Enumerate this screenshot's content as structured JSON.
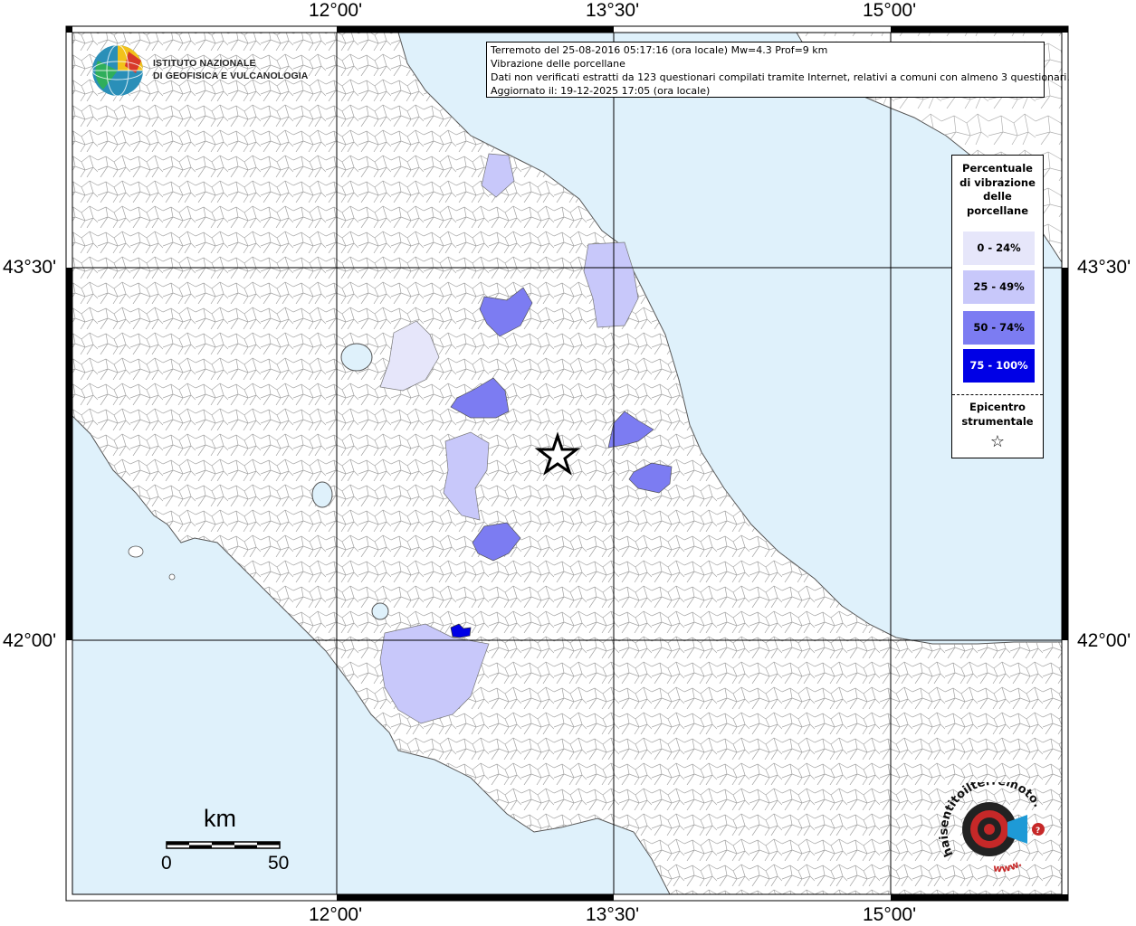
{
  "info": {
    "line1": "Terremoto del 25-08-2016 05:17:16 (ora locale) Mw=4.3 Prof=9 km",
    "line2": "Vibrazione delle porcellane",
    "line3": "Dati non verificati estratti da 123 questionari compilati tramite Internet, relativi a comuni con almeno 3 questionari.",
    "line4": "Aggiornato il: 19-12-2025 17:05 (ora locale)"
  },
  "logo": {
    "line1": "ISTITUTO NAZIONALE",
    "line2": "DI GEOFISICA E VULCANOLOGIA"
  },
  "legend": {
    "title_lines": [
      "Percentuale",
      "di vibrazione",
      "delle",
      "porcellane"
    ],
    "classes": [
      {
        "label": "0 - 24%",
        "color": "#e6e6fa"
      },
      {
        "label": "25 - 49%",
        "color": "#c8c8fa"
      },
      {
        "label": "50 - 74%",
        "color": "#7c7cf2"
      },
      {
        "label": "75 - 100%",
        "color": "#0000e6"
      }
    ],
    "epicenter_lines": [
      "Epicentro",
      "strumentale"
    ],
    "epicenter_symbol": "☆"
  },
  "axes": {
    "lon_labels": [
      "12°00'",
      "13°30'",
      "15°00'"
    ],
    "lat_labels": [
      "43°30'",
      "42°00'"
    ]
  },
  "scalebar": {
    "unit": "km",
    "start": "0",
    "end": "50"
  },
  "brand": {
    "text_top": "haisentitoilterremoto.it",
    "text_bottom": "www."
  },
  "colors": {
    "sea": "#dff1fb",
    "land": "#ffffff",
    "border": "#8a8a8a",
    "frame": "#000000"
  }
}
